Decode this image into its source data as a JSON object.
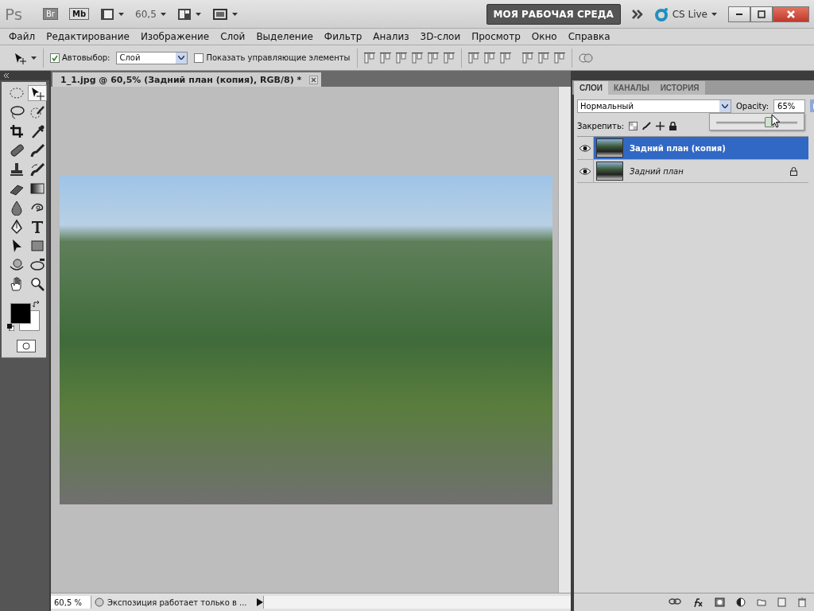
{
  "app_bar": {
    "logo": "Ps",
    "bridge": "Br",
    "mini_bridge": "Mb",
    "zoom": "60,5",
    "workspace_button": "МОЯ РАБОЧАЯ СРЕДА",
    "cs_live": "CS Live"
  },
  "menu": [
    "Файл",
    "Редактирование",
    "Изображение",
    "Слой",
    "Выделение",
    "Фильтр",
    "Анализ",
    "3D-слои",
    "Просмотр",
    "Окно",
    "Справка"
  ],
  "options_bar": {
    "auto_select": {
      "label": "Автовыбор:",
      "checked": true,
      "value": "Слой"
    },
    "show_controls": {
      "label": "Показать управляющие элементы",
      "checked": false
    }
  },
  "tools": [
    {
      "kind": "marquee",
      "selected": false
    },
    {
      "kind": "move",
      "selected": true
    },
    {
      "kind": "lasso",
      "selected": false
    },
    {
      "kind": "quick-select",
      "selected": false
    },
    {
      "kind": "crop",
      "selected": false
    },
    {
      "kind": "eyedropper",
      "selected": false
    },
    {
      "kind": "healing",
      "selected": false
    },
    {
      "kind": "brush",
      "selected": false
    },
    {
      "kind": "stamp",
      "selected": false
    },
    {
      "kind": "history-brush",
      "selected": false
    },
    {
      "kind": "eraser",
      "selected": false
    },
    {
      "kind": "gradient",
      "selected": false
    },
    {
      "kind": "blur",
      "selected": false
    },
    {
      "kind": "dodge",
      "selected": false
    },
    {
      "kind": "pen",
      "selected": false
    },
    {
      "kind": "type",
      "selected": false
    },
    {
      "kind": "path-select",
      "selected": false
    },
    {
      "kind": "shape",
      "selected": false
    },
    {
      "kind": "rotate-3d",
      "selected": false
    },
    {
      "kind": "orbit-3d",
      "selected": false
    },
    {
      "kind": "hand",
      "selected": false
    },
    {
      "kind": "zoom",
      "selected": false
    }
  ],
  "document": {
    "tab_title": "1_1.jpg @ 60,5% (Задний план (копия), RGB/8) *"
  },
  "status_bar": {
    "zoom": "60,5 %",
    "info": "Экспозиция работает только в ..."
  },
  "layers_panel": {
    "tabs": [
      {
        "label": "СЛОИ",
        "selected": true
      },
      {
        "label": "КАНАЛЫ",
        "selected": false
      },
      {
        "label": "ИСТОРИЯ",
        "selected": false
      }
    ],
    "blend_mode": "Нормальный",
    "opacity_label": "Opacity:",
    "opacity": "65%",
    "opacity_slider": {
      "level": 0.65
    },
    "lock_label": "Закрепить:",
    "layers": [
      {
        "name": "Задний план (копия)",
        "selected": true,
        "visible": true,
        "locked": false
      },
      {
        "name": "Задний план",
        "selected": false,
        "visible": true,
        "locked": true
      }
    ]
  }
}
